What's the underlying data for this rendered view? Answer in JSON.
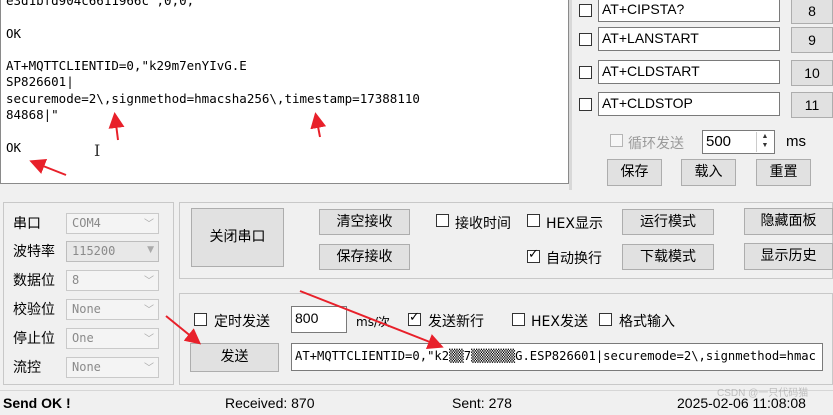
{
  "receive": {
    "text": "e3d1bfd904c6611966c\",0,0,\"\"\n\nOK\n\nAT+MQTTCLIENTID=0,\"k29m7enYIvG.E\nSP826601|\nsecuremode=2\\,signmethod=hmacsha256\\,timestamp=17388110\n84868|\"\n\nOK"
  },
  "commands": [
    {
      "text": "AT+CIPSTA?",
      "num": "8"
    },
    {
      "text": "AT+LANSTART",
      "num": "9"
    },
    {
      "text": "AT+CLDSTART",
      "num": "10"
    },
    {
      "text": "AT+CLDSTOP",
      "num": "11"
    }
  ],
  "loop": {
    "label": "循环发送",
    "value": "500",
    "unit": "ms"
  },
  "cmd_buttons": {
    "save": "保存",
    "load": "载入",
    "reset": "重置"
  },
  "port": {
    "rows": [
      {
        "label": "串口",
        "value": "COM4"
      },
      {
        "label": "波特率",
        "value": "115200"
      },
      {
        "label": "数据位",
        "value": "8"
      },
      {
        "label": "校验位",
        "value": "None"
      },
      {
        "label": "停止位",
        "value": "One"
      },
      {
        "label": "流控",
        "value": "None"
      }
    ]
  },
  "buttons": {
    "close_port": "关闭串口",
    "clear_recv": "清空接收",
    "save_recv": "保存接收",
    "run_mode": "运行模式",
    "download_mode": "下载模式",
    "hide_panel": "隐藏面板",
    "show_history": "显示历史",
    "send": "发送"
  },
  "options": {
    "recv_time": "接收时间",
    "hex_show": "HEX显示",
    "auto_wrap": "自动换行",
    "timed_send": "定时发送",
    "send_newline": "发送新行",
    "hex_send": "HEX发送",
    "format_input": "格式输入"
  },
  "timer": {
    "value": "800",
    "unit": "ms/次"
  },
  "send_text": "AT+MQTTCLIENTID=0,\"k2▒▒7▒▒▒▒▒▒G.ESP826601|securemode=2\\,signmethod=hmac",
  "status": {
    "send_ok": "Send OK !",
    "received": "Received: 870",
    "sent": "Sent: 278",
    "datetime": "2025-02-06 11:08:08",
    "watermark": "CSDN @一只代码猫"
  },
  "colors": {
    "arrow": "#e8202a",
    "statusbar": "#f0f0f0"
  }
}
